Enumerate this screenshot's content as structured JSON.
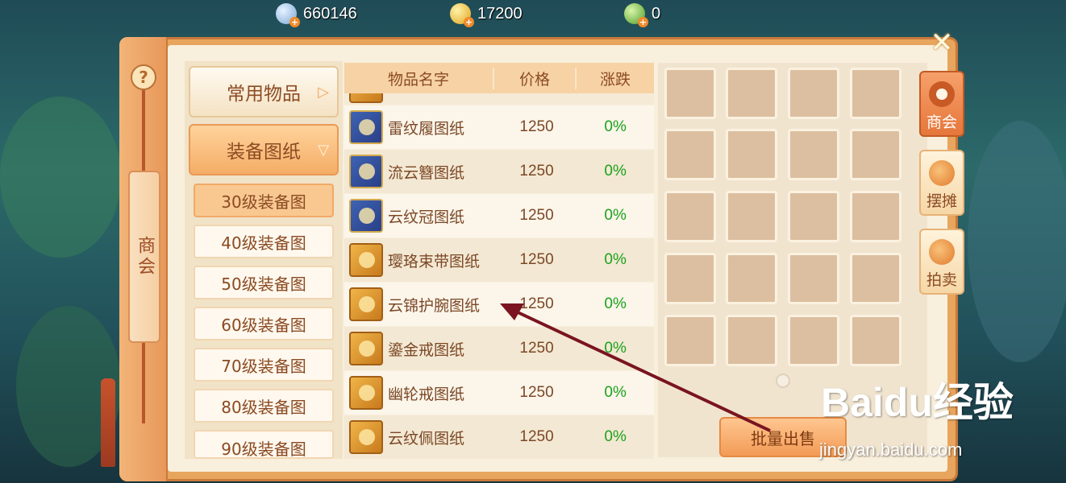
{
  "currency": [
    {
      "icon": "silver-coin-icon",
      "value": "660146"
    },
    {
      "icon": "gold-coin-icon",
      "value": "17200"
    },
    {
      "icon": "jade-coin-icon",
      "value": "0"
    }
  ],
  "left_panel": {
    "help": "?",
    "title": "商会"
  },
  "categories": [
    {
      "label": "常用物品",
      "arrow": "▷"
    },
    {
      "label": "装备图纸",
      "arrow": "▽"
    }
  ],
  "sub_categories": [
    "30级装备图",
    "40级装备图",
    "50级装备图",
    "60级装备图",
    "70级装备图",
    "80级装备图",
    "90级装备图"
  ],
  "list": {
    "headers": {
      "name": "物品名字",
      "price": "价格",
      "change": "涨跌"
    },
    "rows": [
      {
        "name": "雷纹履图纸",
        "price": "1250",
        "change": "0%",
        "icon": "blue-book-icon"
      },
      {
        "name": "流云簪图纸",
        "price": "1250",
        "change": "0%",
        "icon": "blue-book-icon"
      },
      {
        "name": "云纹冠图纸",
        "price": "1250",
        "change": "0%",
        "icon": "blue-book-icon"
      },
      {
        "name": "璎珞束带图纸",
        "price": "1250",
        "change": "0%",
        "icon": "gold-book-icon"
      },
      {
        "name": "云锦护腕图纸",
        "price": "1250",
        "change": "0%",
        "icon": "gold-book-icon"
      },
      {
        "name": "鎏金戒图纸",
        "price": "1250",
        "change": "0%",
        "icon": "gold-book-icon"
      },
      {
        "name": "幽轮戒图纸",
        "price": "1250",
        "change": "0%",
        "icon": "gold-book-icon"
      },
      {
        "name": "云纹佩图纸",
        "price": "1250",
        "change": "0%",
        "icon": "gold-book-icon"
      }
    ]
  },
  "inventory": {
    "batch_sell_label": "批量出售"
  },
  "side_tabs": [
    {
      "label": "商会",
      "icon": "guild-icon",
      "active": true
    },
    {
      "label": "摆摊",
      "icon": "stall-icon",
      "active": false
    },
    {
      "label": "拍卖",
      "icon": "auction-icon",
      "active": false
    }
  ],
  "watermark": {
    "logo": "Baidu经验",
    "site": "jingyan.baidu.com"
  }
}
